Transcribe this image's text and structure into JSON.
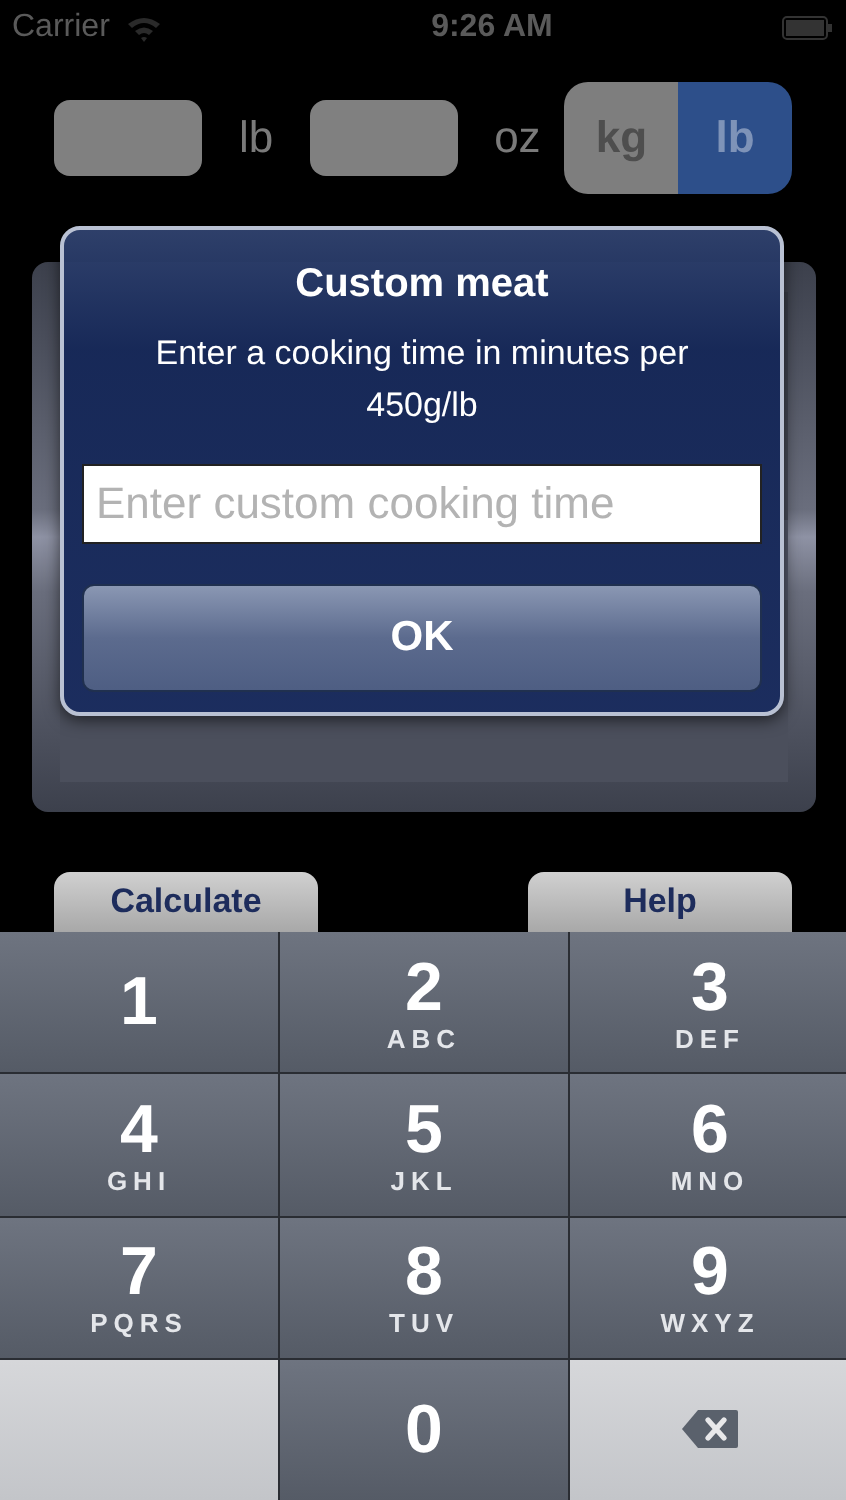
{
  "status_bar": {
    "carrier": "Carrier",
    "time": "9:26 AM"
  },
  "weight": {
    "fields": [
      {
        "unit": "lb"
      },
      {
        "unit": "oz"
      }
    ],
    "units": [
      {
        "label": "kg",
        "selected": false
      },
      {
        "label": "lb",
        "selected": true
      }
    ]
  },
  "alert": {
    "title": "Custom meat",
    "message": "Enter a cooking time in minutes per 450g/lb",
    "field": {
      "placeholder": "Enter custom cooking time"
    },
    "button": "OK"
  },
  "buttons": [
    "Calculate",
    "Help"
  ],
  "keypad": [
    {
      "kind": "digit",
      "digit": "1"
    },
    {
      "kind": "digit",
      "digit": "2",
      "letters": "ABC"
    },
    {
      "kind": "digit",
      "digit": "3",
      "letters": "DEF"
    },
    {
      "kind": "digit",
      "digit": "4",
      "letters": "GHI"
    },
    {
      "kind": "digit",
      "digit": "5",
      "letters": "JKL"
    },
    {
      "kind": "digit",
      "digit": "6",
      "letters": "MNO"
    },
    {
      "kind": "digit",
      "digit": "7",
      "letters": "PQRS"
    },
    {
      "kind": "digit",
      "digit": "8",
      "letters": "TUV"
    },
    {
      "kind": "digit",
      "digit": "9",
      "letters": "WXYZ"
    },
    {
      "kind": "blank"
    },
    {
      "kind": "digit",
      "digit": "0"
    },
    {
      "kind": "delete"
    }
  ]
}
